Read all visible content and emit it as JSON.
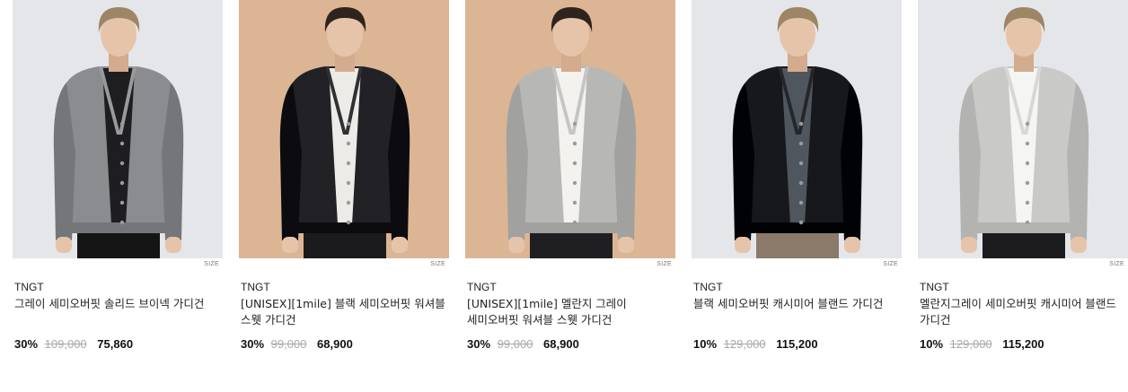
{
  "products": [
    {
      "size_label": "SIZE",
      "brand": "TNGT",
      "name": "그레이 세미오버핏 솔리드 브이넥 가디건",
      "discount": "30%",
      "original_price": "109,000",
      "sale_price": "75,860",
      "bg_color": "#e4e6e9",
      "garment_color": "#8a8c8f",
      "inner_color": "#1e1e20",
      "pants_color": "#151515",
      "hair_color": "#9c8666"
    },
    {
      "size_label": "SIZE",
      "brand": "TNGT",
      "name": "[UNISEX][1mile] 블랙 세미오버핏 워셔블 스웻 가디건",
      "discount": "30%",
      "original_price": "99,000",
      "sale_price": "68,900",
      "bg_color": "#dcb594",
      "garment_color": "#222226",
      "inner_color": "#ecebe7",
      "pants_color": "#1b1b1d",
      "hair_color": "#2f241d"
    },
    {
      "size_label": "SIZE",
      "brand": "TNGT",
      "name": "[UNISEX][1mile] 멜란지 그레이 세미오버핏 워셔블 스웻 가디건",
      "discount": "30%",
      "original_price": "99,000",
      "sale_price": "68,900",
      "bg_color": "#dcb594",
      "garment_color": "#b7b7b5",
      "inner_color": "#f3f2ee",
      "pants_color": "#1f1f21",
      "hair_color": "#2f241d"
    },
    {
      "size_label": "SIZE",
      "brand": "TNGT",
      "name": "블랙 세미오버핏 캐시미어 블랜드 가디건",
      "discount": "10%",
      "original_price": "129,000",
      "sale_price": "115,200",
      "bg_color": "#e4e6e9",
      "garment_color": "#17181c",
      "inner_color": "#50565e",
      "pants_color": "#8b7a69",
      "hair_color": "#9c8666"
    },
    {
      "size_label": "SIZE",
      "brand": "TNGT",
      "name": "멜란지그레이 세미오버핏 캐시미어 블랜드 가디건",
      "discount": "10%",
      "original_price": "129,000",
      "sale_price": "115,200",
      "bg_color": "#e4e6e9",
      "garment_color": "#c9c9c7",
      "inner_color": "#f5f5f3",
      "pants_color": "#1c1c1e",
      "hair_color": "#9c8666"
    }
  ]
}
